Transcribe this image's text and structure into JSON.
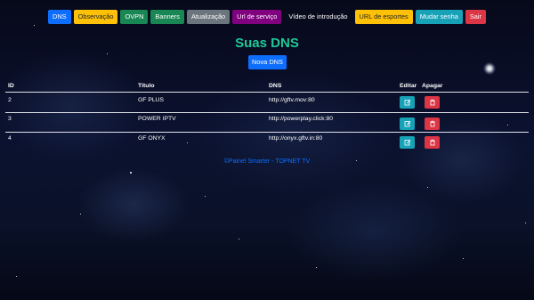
{
  "nav": {
    "items": [
      {
        "label": "DNS",
        "color": "#0d6efd"
      },
      {
        "label": "Observação",
        "color": "#ffc107"
      },
      {
        "label": "OVPN",
        "color": "#198754"
      },
      {
        "label": "Banners",
        "color": "#198754"
      },
      {
        "label": "Atualização",
        "color": "#6c757d"
      },
      {
        "label": "Url de serviço",
        "color": "#800080"
      },
      {
        "label": "Vídeo de introdução",
        "color": "transparent"
      },
      {
        "label": "URL de esportes",
        "color": "#ffc107"
      },
      {
        "label": "Mudar senha",
        "color": "#17a2b8"
      },
      {
        "label": "Sair",
        "color": "#dc3545"
      }
    ]
  },
  "page": {
    "title": "Suas DNS",
    "new_button": "Nova DNS"
  },
  "table": {
    "headers": {
      "id": "ID",
      "title": "Título",
      "dns": "DNS",
      "edit": "Editar",
      "delete": "Apagar"
    },
    "rows": [
      {
        "id": "2",
        "title": "GF PLUS",
        "dns": "http://gftv.mov:80"
      },
      {
        "id": "3",
        "title": "POWER IPTV",
        "dns": "http://powerplay.click:80"
      },
      {
        "id": "4",
        "title": "GF ONYX",
        "dns": "http://onyx.gftv.in:80"
      }
    ],
    "edit_icon": "edit-icon",
    "delete_icon": "trash-icon"
  },
  "footer": {
    "text": "©Painel Smarter - TOPNET TV"
  }
}
